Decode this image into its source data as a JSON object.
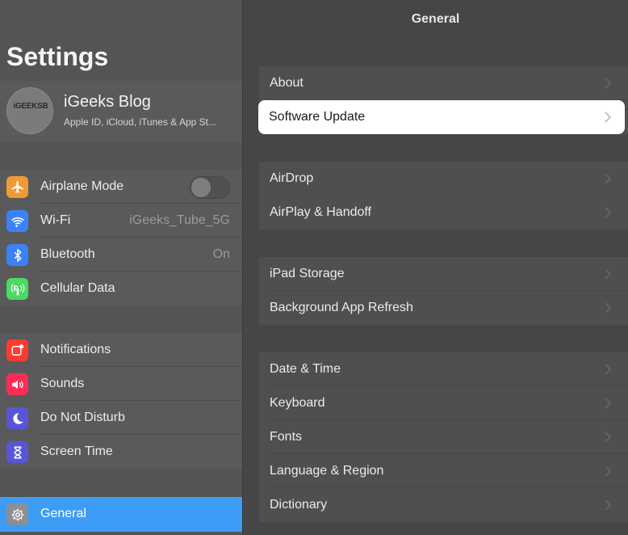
{
  "sidebar": {
    "title": "Settings",
    "profile": {
      "avatar_text": "iGEEKSB",
      "name": "iGeeks Blog",
      "subtitle": "Apple ID, iCloud, iTunes & App St..."
    },
    "group1": [
      {
        "label": "Airplane Mode",
        "icon": "airplane-icon",
        "color": "#f09a37",
        "toggle": false
      },
      {
        "label": "Wi-Fi",
        "icon": "wifi-icon",
        "color": "#3b82f6",
        "value": "iGeeks_Tube_5G"
      },
      {
        "label": "Bluetooth",
        "icon": "bluetooth-icon",
        "color": "#3b82f6",
        "value": "On"
      },
      {
        "label": "Cellular Data",
        "icon": "cellular-icon",
        "color": "#4cd964"
      }
    ],
    "group2": [
      {
        "label": "Notifications",
        "icon": "notifications-icon",
        "color": "#ff3b30"
      },
      {
        "label": "Sounds",
        "icon": "sounds-icon",
        "color": "#ff2d55"
      },
      {
        "label": "Do Not Disturb",
        "icon": "moon-icon",
        "color": "#5856d6"
      },
      {
        "label": "Screen Time",
        "icon": "hourglass-icon",
        "color": "#5856d6"
      }
    ],
    "general": {
      "label": "General",
      "icon": "gear-icon",
      "color": "#8e8e93",
      "selected_color": "#3d9cf5"
    }
  },
  "main": {
    "title": "General",
    "groups": [
      [
        "About",
        "Software Update"
      ],
      [
        "AirDrop",
        "AirPlay & Handoff"
      ],
      [
        "iPad Storage",
        "Background App Refresh"
      ],
      [
        "Date & Time",
        "Keyboard",
        "Fonts",
        "Language & Region",
        "Dictionary"
      ]
    ],
    "highlighted_item": "Software Update"
  }
}
